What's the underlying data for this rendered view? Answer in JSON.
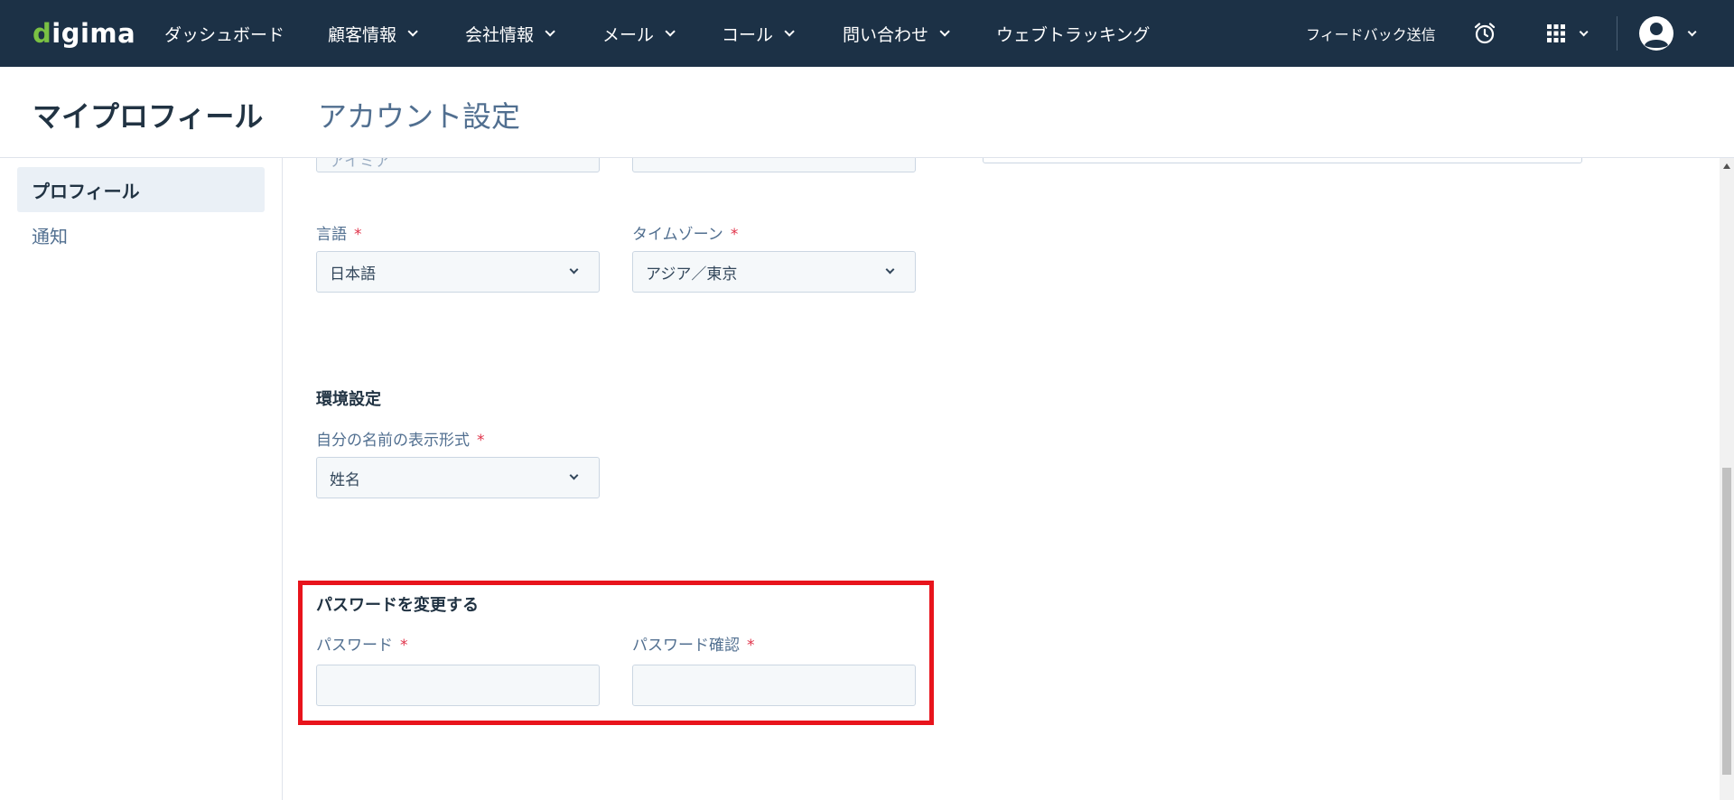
{
  "brand": {
    "logo_first": "d",
    "logo_rest": "igima",
    "logo_colors": {
      "accent": "#7ac143",
      "nav_bg": "#1c3146"
    }
  },
  "nav": {
    "items": [
      {
        "label": "ダッシュボード",
        "has_dropdown": false
      },
      {
        "label": "顧客情報",
        "has_dropdown": true
      },
      {
        "label": "会社情報",
        "has_dropdown": true
      },
      {
        "label": "メール",
        "has_dropdown": true
      },
      {
        "label": "コール",
        "has_dropdown": true
      },
      {
        "label": "問い合わせ",
        "has_dropdown": true
      },
      {
        "label": "ウェブトラッキング",
        "has_dropdown": false
      }
    ],
    "feedback_label": "フィードバック送信",
    "icons": {
      "alarm": "alarm-clock-icon",
      "apps": "apps-grid-icon",
      "user": "user-avatar-icon"
    }
  },
  "header": {
    "title": "マイプロフィール",
    "tab": "アカウント設定"
  },
  "sidebar": {
    "items": [
      {
        "label": "プロフィール",
        "active": true
      },
      {
        "label": "通知",
        "active": false
      }
    ]
  },
  "form": {
    "partial_top_value": "アイミア",
    "language": {
      "label": "言語",
      "value": "日本語"
    },
    "timezone": {
      "label": "タイムゾーン",
      "value": "アジア／東京"
    },
    "preferences_title": "環境設定",
    "name_format": {
      "label": "自分の名前の表示形式",
      "value": "姓名"
    },
    "password_section": {
      "title": "パスワードを変更する",
      "password_label": "パスワード",
      "password_value": "",
      "confirm_label": "パスワード確認",
      "confirm_value": ""
    },
    "required_mark": "*"
  },
  "colors": {
    "highlight": "#e8141c",
    "required": "#e0334a"
  }
}
